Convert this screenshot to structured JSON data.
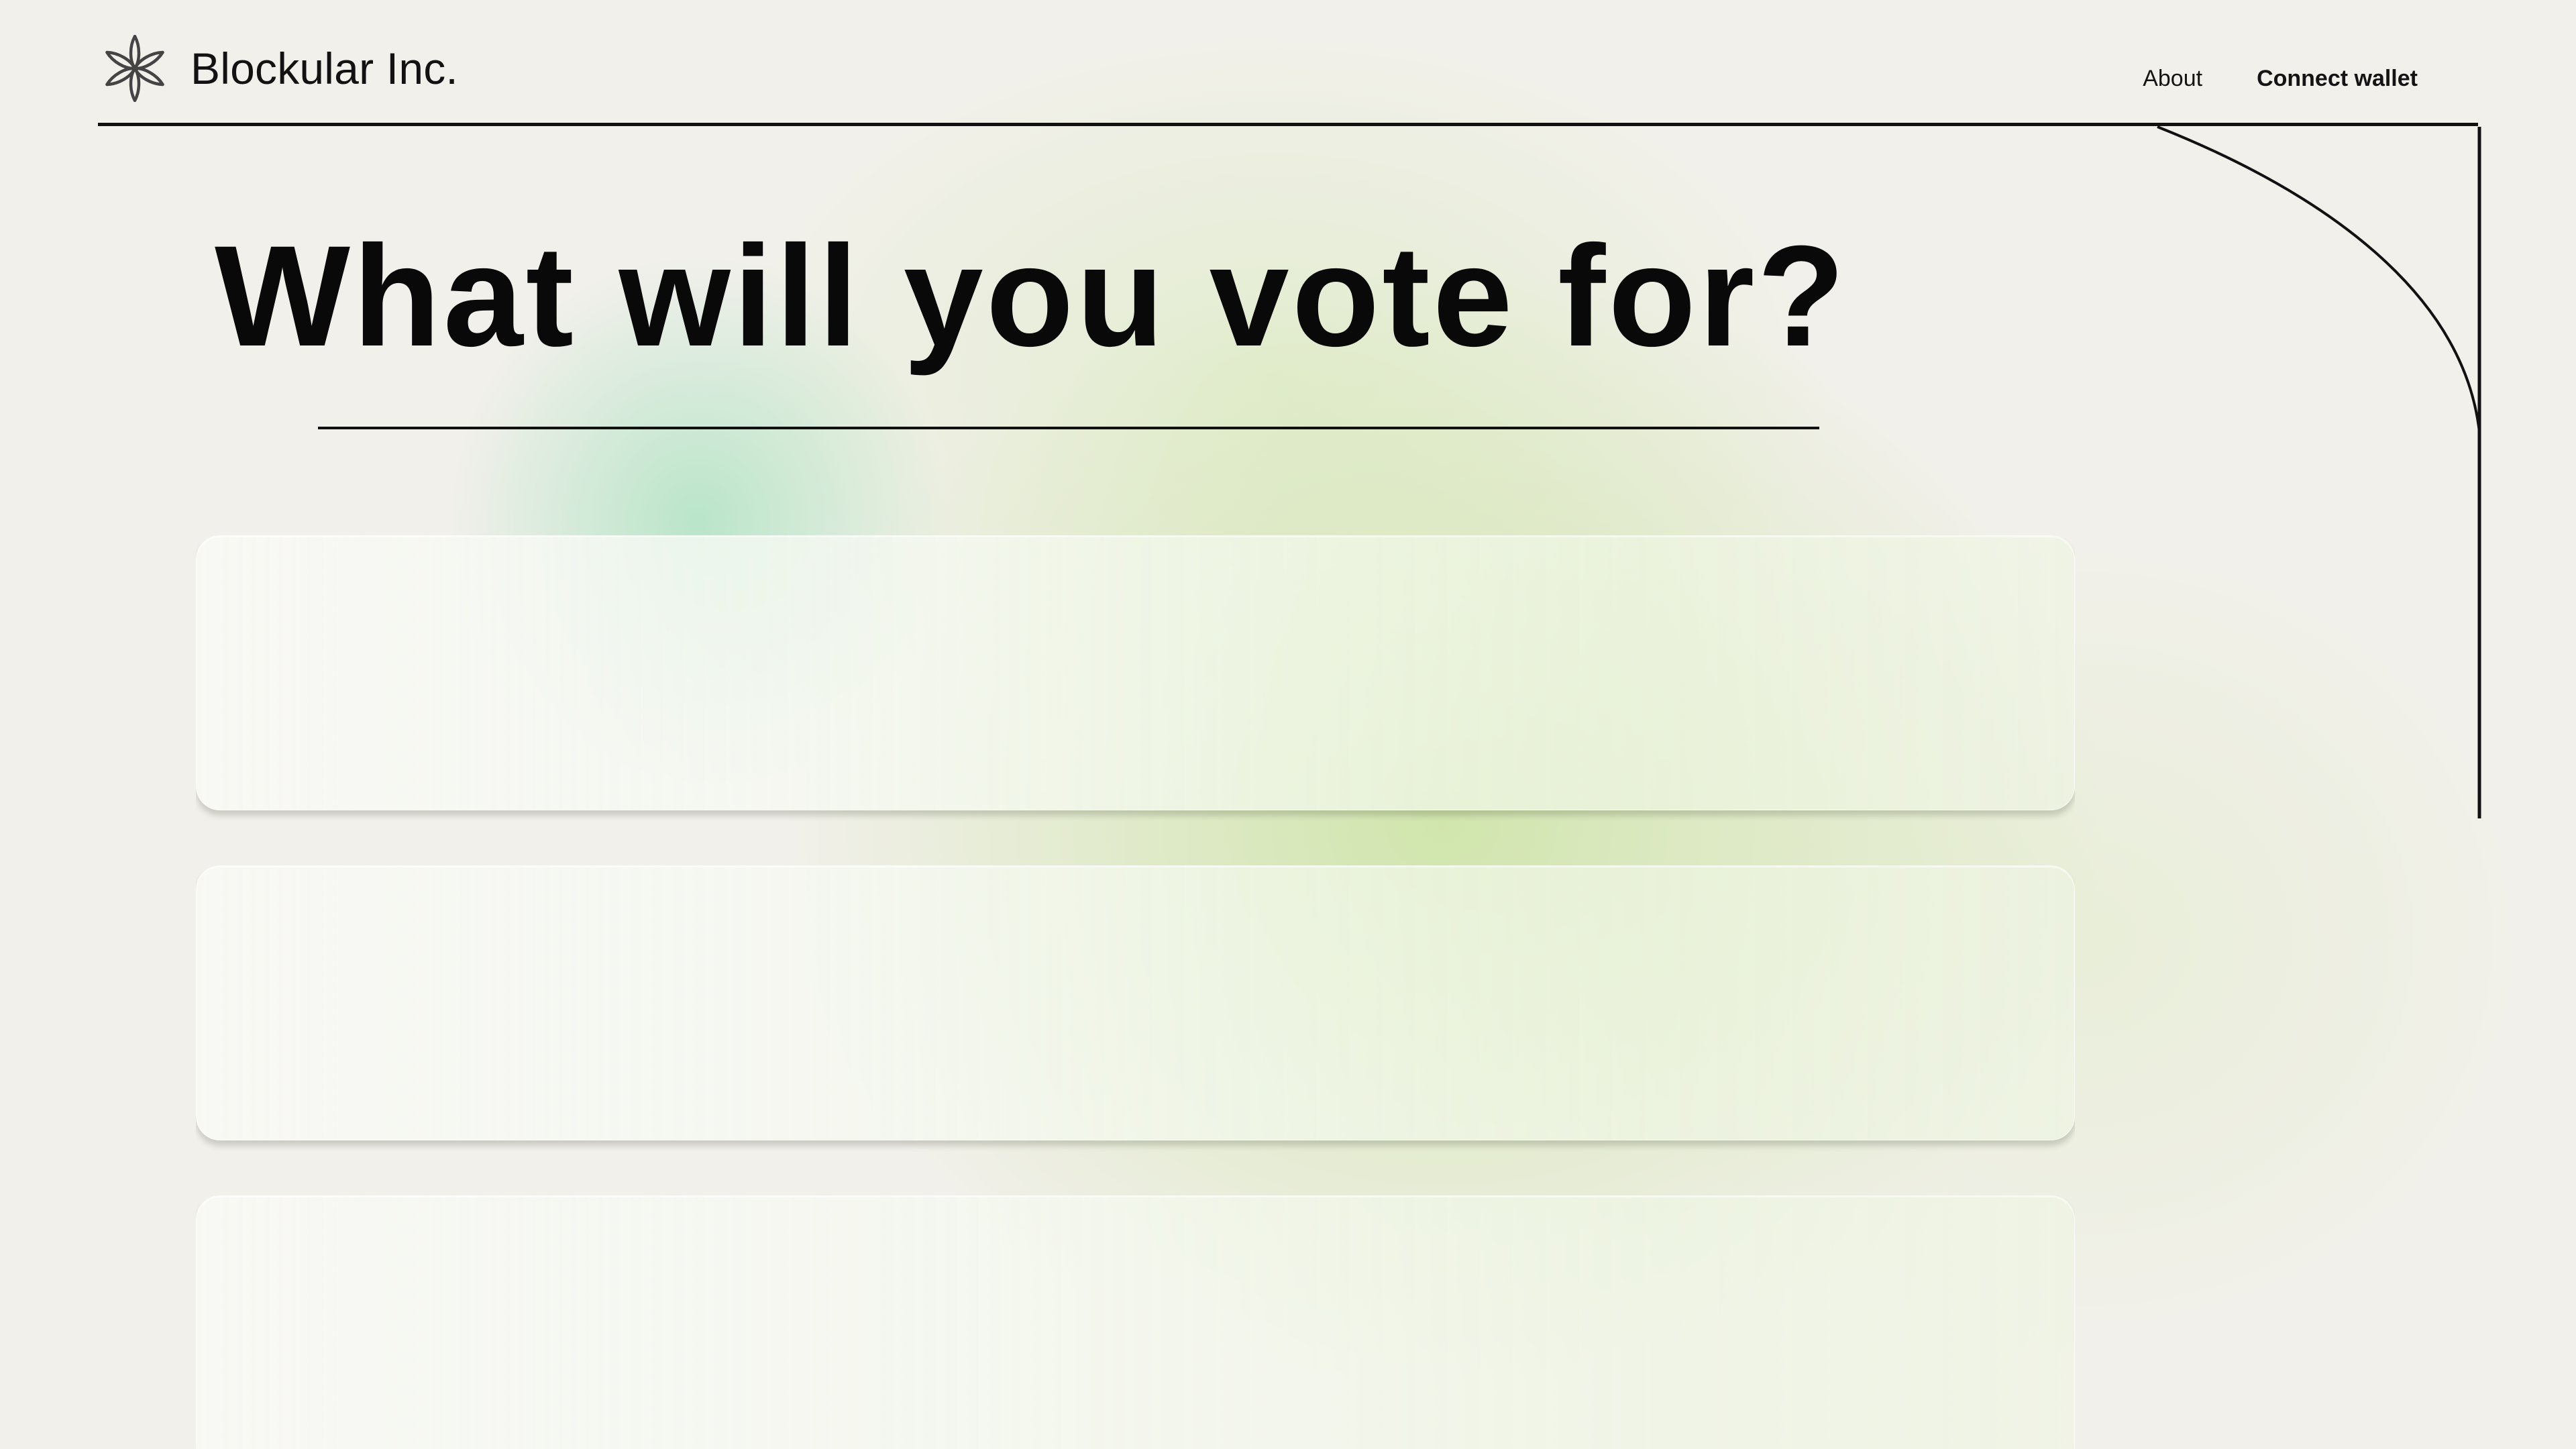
{
  "brand": {
    "name": "Blockular Inc.",
    "logo_icon": "six-petal-flower-icon"
  },
  "nav": {
    "about": "About",
    "connect_wallet": "Connect wallet"
  },
  "hero": {
    "title": "What will you vote for?"
  },
  "vote_options": [
    {
      "label": ""
    },
    {
      "label": ""
    },
    {
      "label": ""
    }
  ],
  "colors": {
    "background": "#f2f0eb",
    "text": "#0b0b0b",
    "mint_glow": "#96deb4",
    "lime_glow": "#c7e29b",
    "card_surface": "#f8f8f4"
  }
}
